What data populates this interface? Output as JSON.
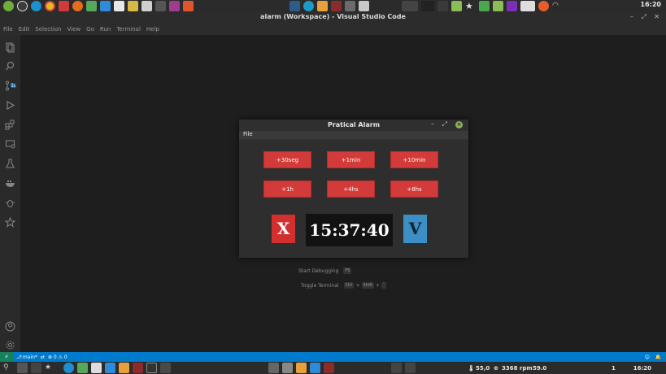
{
  "taskbar_top": {
    "clock": "16:20",
    "icons": [
      "mint-menu-icon",
      "clock-icon",
      "edge-icon",
      "chrome-icon",
      "vivaldi-icon",
      "firefox-icon",
      "files-icon",
      "vscode-icon",
      "document-icon",
      "folder-icon",
      "notes-icon",
      "terminal-icon",
      "image-viewer-icon",
      "brave-icon"
    ]
  },
  "vscode": {
    "title": "alarm (Workspace) - Visual Studio Code",
    "menu": [
      "File",
      "Edit",
      "Selection",
      "View",
      "Go",
      "Run",
      "Terminal",
      "Help"
    ],
    "source_control_badge": "21",
    "shortcuts": [
      {
        "label": "Start Debugging",
        "keys": [
          "F5"
        ]
      },
      {
        "label": "Toggle Terminal",
        "keys": [
          "Ctrl",
          "+",
          "Shift",
          "+",
          "`"
        ]
      }
    ],
    "status": {
      "branch": "main*",
      "problems": "⊗ 0 ⚠ 0"
    }
  },
  "alarm_app": {
    "title": "Pratical Alarm",
    "menu_file": "File",
    "buttons": {
      "add_30s": "+30seg",
      "add_1min": "+1min",
      "add_10min": "+10min",
      "add_1h": "+1h",
      "add_4h": "+4hs",
      "add_8h": "+8hs"
    },
    "cancel_label": "X",
    "time": "15:37:40",
    "confirm_label": "V"
  },
  "taskbar_bottom": {
    "temp": "55,0",
    "rpm": "3368 rpm",
    "temp2": "59.0",
    "clock": "16:20",
    "count": "1"
  },
  "colors": {
    "accent_red": "#d33a3a",
    "accent_blue": "#3c8ec4",
    "statusbar_blue": "#007acc"
  }
}
